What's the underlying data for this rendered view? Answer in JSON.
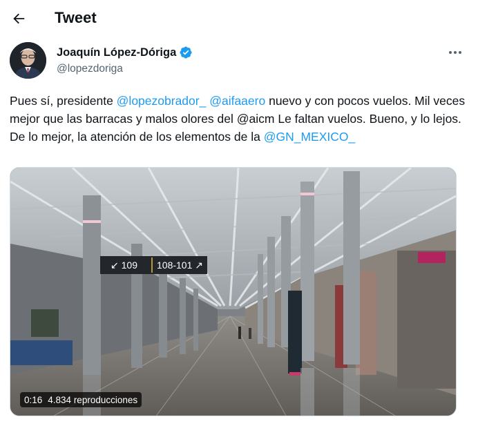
{
  "header": {
    "title": "Tweet",
    "back_icon": "arrow-left-icon"
  },
  "author": {
    "name": "Joaquín López-Dóriga",
    "handle": "@lopezdoriga",
    "verified_icon": "verified-badge-icon",
    "verified_color": "#1d9bf0",
    "more_icon": "more-horizontal-icon"
  },
  "tweet": {
    "segments": [
      {
        "text": "Pues sí, presidente ",
        "type": "text"
      },
      {
        "text": "@lopezobrador_",
        "type": "mention"
      },
      {
        "text": " ",
        "type": "text"
      },
      {
        "text": "@aifaaero",
        "type": "mention"
      },
      {
        "text": " nuevo y con pocos vuelos. Mil veces mejor que las barracas y malos olores del @aicm Le faltan vuelos. Bueno, y lo lejos. De lo mejor, la atención de los elementos de la ",
        "type": "text"
      },
      {
        "text": "@GN_MEXICO_",
        "type": "mention"
      }
    ]
  },
  "media": {
    "sign_left": "↙ 109",
    "sign_right": "108-101 ↗",
    "duration": "0:16",
    "views": "4.834 reproducciones"
  },
  "colors": {
    "accent": "#1d9bf0",
    "text_primary": "#0f1419",
    "text_secondary": "#536471"
  }
}
